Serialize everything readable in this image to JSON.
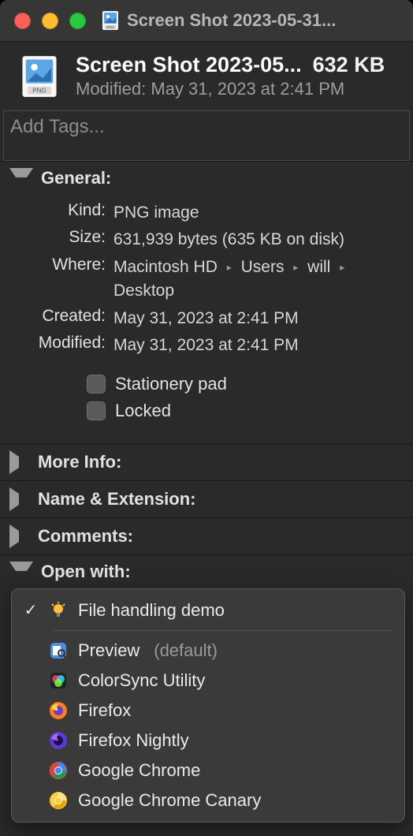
{
  "titlebar": {
    "title": "Screen Shot 2023-05-31..."
  },
  "header": {
    "filename": "Screen Shot 2023-05...",
    "size_short": "632 KB",
    "modified_line": "Modified: May 31, 2023 at 2:41 PM"
  },
  "tags": {
    "placeholder": "Add Tags..."
  },
  "sections": {
    "general": {
      "label": "General:",
      "items": {
        "kind_label": "Kind:",
        "kind_value": "PNG image",
        "size_label": "Size:",
        "size_value": "631,939 bytes (635 KB on disk)",
        "where_label": "Where:",
        "where_parts": [
          "Macintosh HD",
          "Users",
          "will",
          "Desktop"
        ],
        "created_label": "Created:",
        "created_value": "May 31, 2023 at 2:41 PM",
        "modified_label": "Modified:",
        "modified_value": "May 31, 2023 at 2:41 PM"
      },
      "checks": {
        "stationery": "Stationery pad",
        "locked": "Locked"
      }
    },
    "more_info": {
      "label": "More Info:"
    },
    "name_ext": {
      "label": "Name & Extension:"
    },
    "comments": {
      "label": "Comments:"
    },
    "open_with": {
      "label": "Open with:",
      "default_suffix": "(default)",
      "apps": [
        {
          "name": "File handling demo",
          "selected": true,
          "icon": "bulb"
        },
        {
          "name": "Preview",
          "selected": false,
          "icon": "preview",
          "is_default": true
        },
        {
          "name": "ColorSync Utility",
          "selected": false,
          "icon": "colorsync"
        },
        {
          "name": "Firefox",
          "selected": false,
          "icon": "firefox"
        },
        {
          "name": "Firefox Nightly",
          "selected": false,
          "icon": "firefox-nightly"
        },
        {
          "name": "Google Chrome",
          "selected": false,
          "icon": "chrome"
        },
        {
          "name": "Google Chrome Canary",
          "selected": false,
          "icon": "chrome-canary"
        }
      ]
    }
  }
}
